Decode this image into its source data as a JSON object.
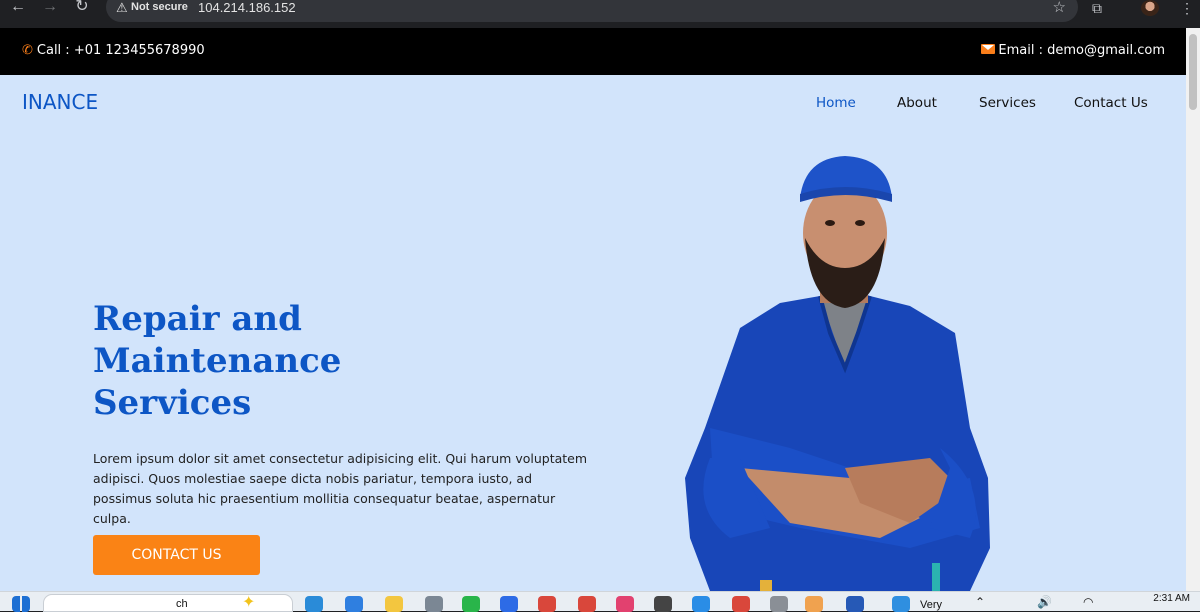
{
  "browser": {
    "security_label": "Not secure",
    "url": "104.214.186.152"
  },
  "topbar": {
    "call": "Call : +01 123455678990",
    "email": "Email : demo@gmail.com"
  },
  "site": {
    "brand": "INANCE",
    "nav": [
      "Home",
      "About",
      "Services",
      "Contact Us"
    ]
  },
  "hero": {
    "title": "Repair and Maintenance Services",
    "text": "Lorem ipsum dolor sit amet consectetur adipisicing elit. Qui harum voluptatem adipisci. Quos molestiae saepe dicta nobis pariatur, tempora iusto, ad possimus soluta hic praesentium mollitia consequatur beatae, aspernatur culpa.",
    "cta": "CONTACT US"
  },
  "taskbar": {
    "search_text": "ch",
    "weather_text": "Very",
    "clock": "2:31 AM"
  },
  "colors": {
    "brand_blue": "#0d56c5",
    "accent_orange": "#fa8315",
    "hero_bg": "#d2e4fb",
    "topbar_bg": "#000000"
  }
}
